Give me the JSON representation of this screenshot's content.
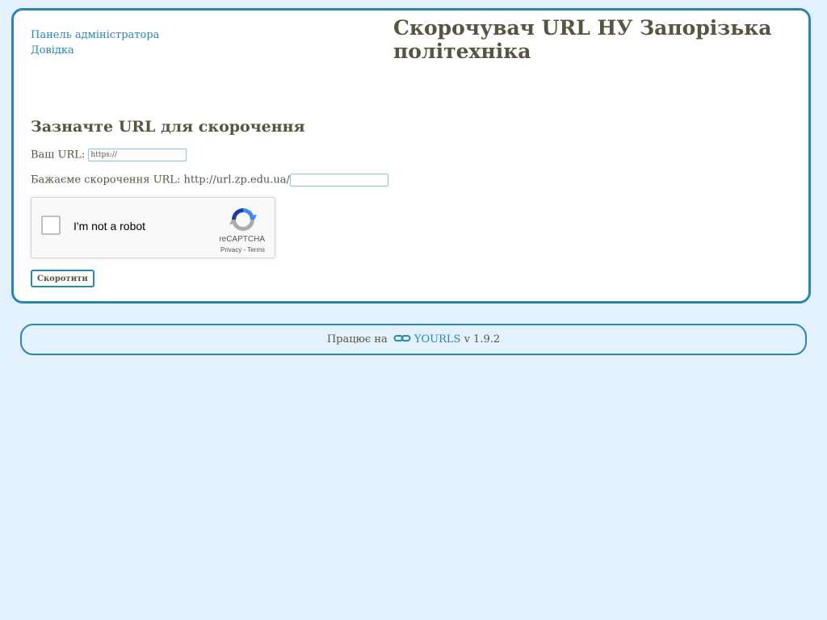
{
  "nav": {
    "admin_label": "Панель адміністратора",
    "help_label": "Довідка"
  },
  "header": {
    "title": "Скорочувач URL НУ Запорізька політехніка"
  },
  "form": {
    "title": "Зазначте URL для скорочення",
    "url_label": "Ваш URL:",
    "url_value": "https://",
    "keyword_label": "Бажаєме скорочення URL: http://url.zp.edu.ua/",
    "keyword_value": "",
    "submit_label": "Скоротити"
  },
  "recaptcha": {
    "checkbox_label": "I'm not a robot",
    "brand": "reCAPTCHA",
    "privacy": "Privacy",
    "separator": "-",
    "terms": "Terms",
    "logo_icon": "recaptcha-logo",
    "logo_colors": [
      "#1c3aa9",
      "#4285f4",
      "#ababab"
    ]
  },
  "footer": {
    "prefix": "Працює на",
    "link_icon": "chain-link-icon",
    "link_label": "YOURLS",
    "version": "v 1.9.2"
  },
  "colors": {
    "accent": "#2a85b3",
    "background": "#e3f1fd",
    "text": "#595441"
  }
}
